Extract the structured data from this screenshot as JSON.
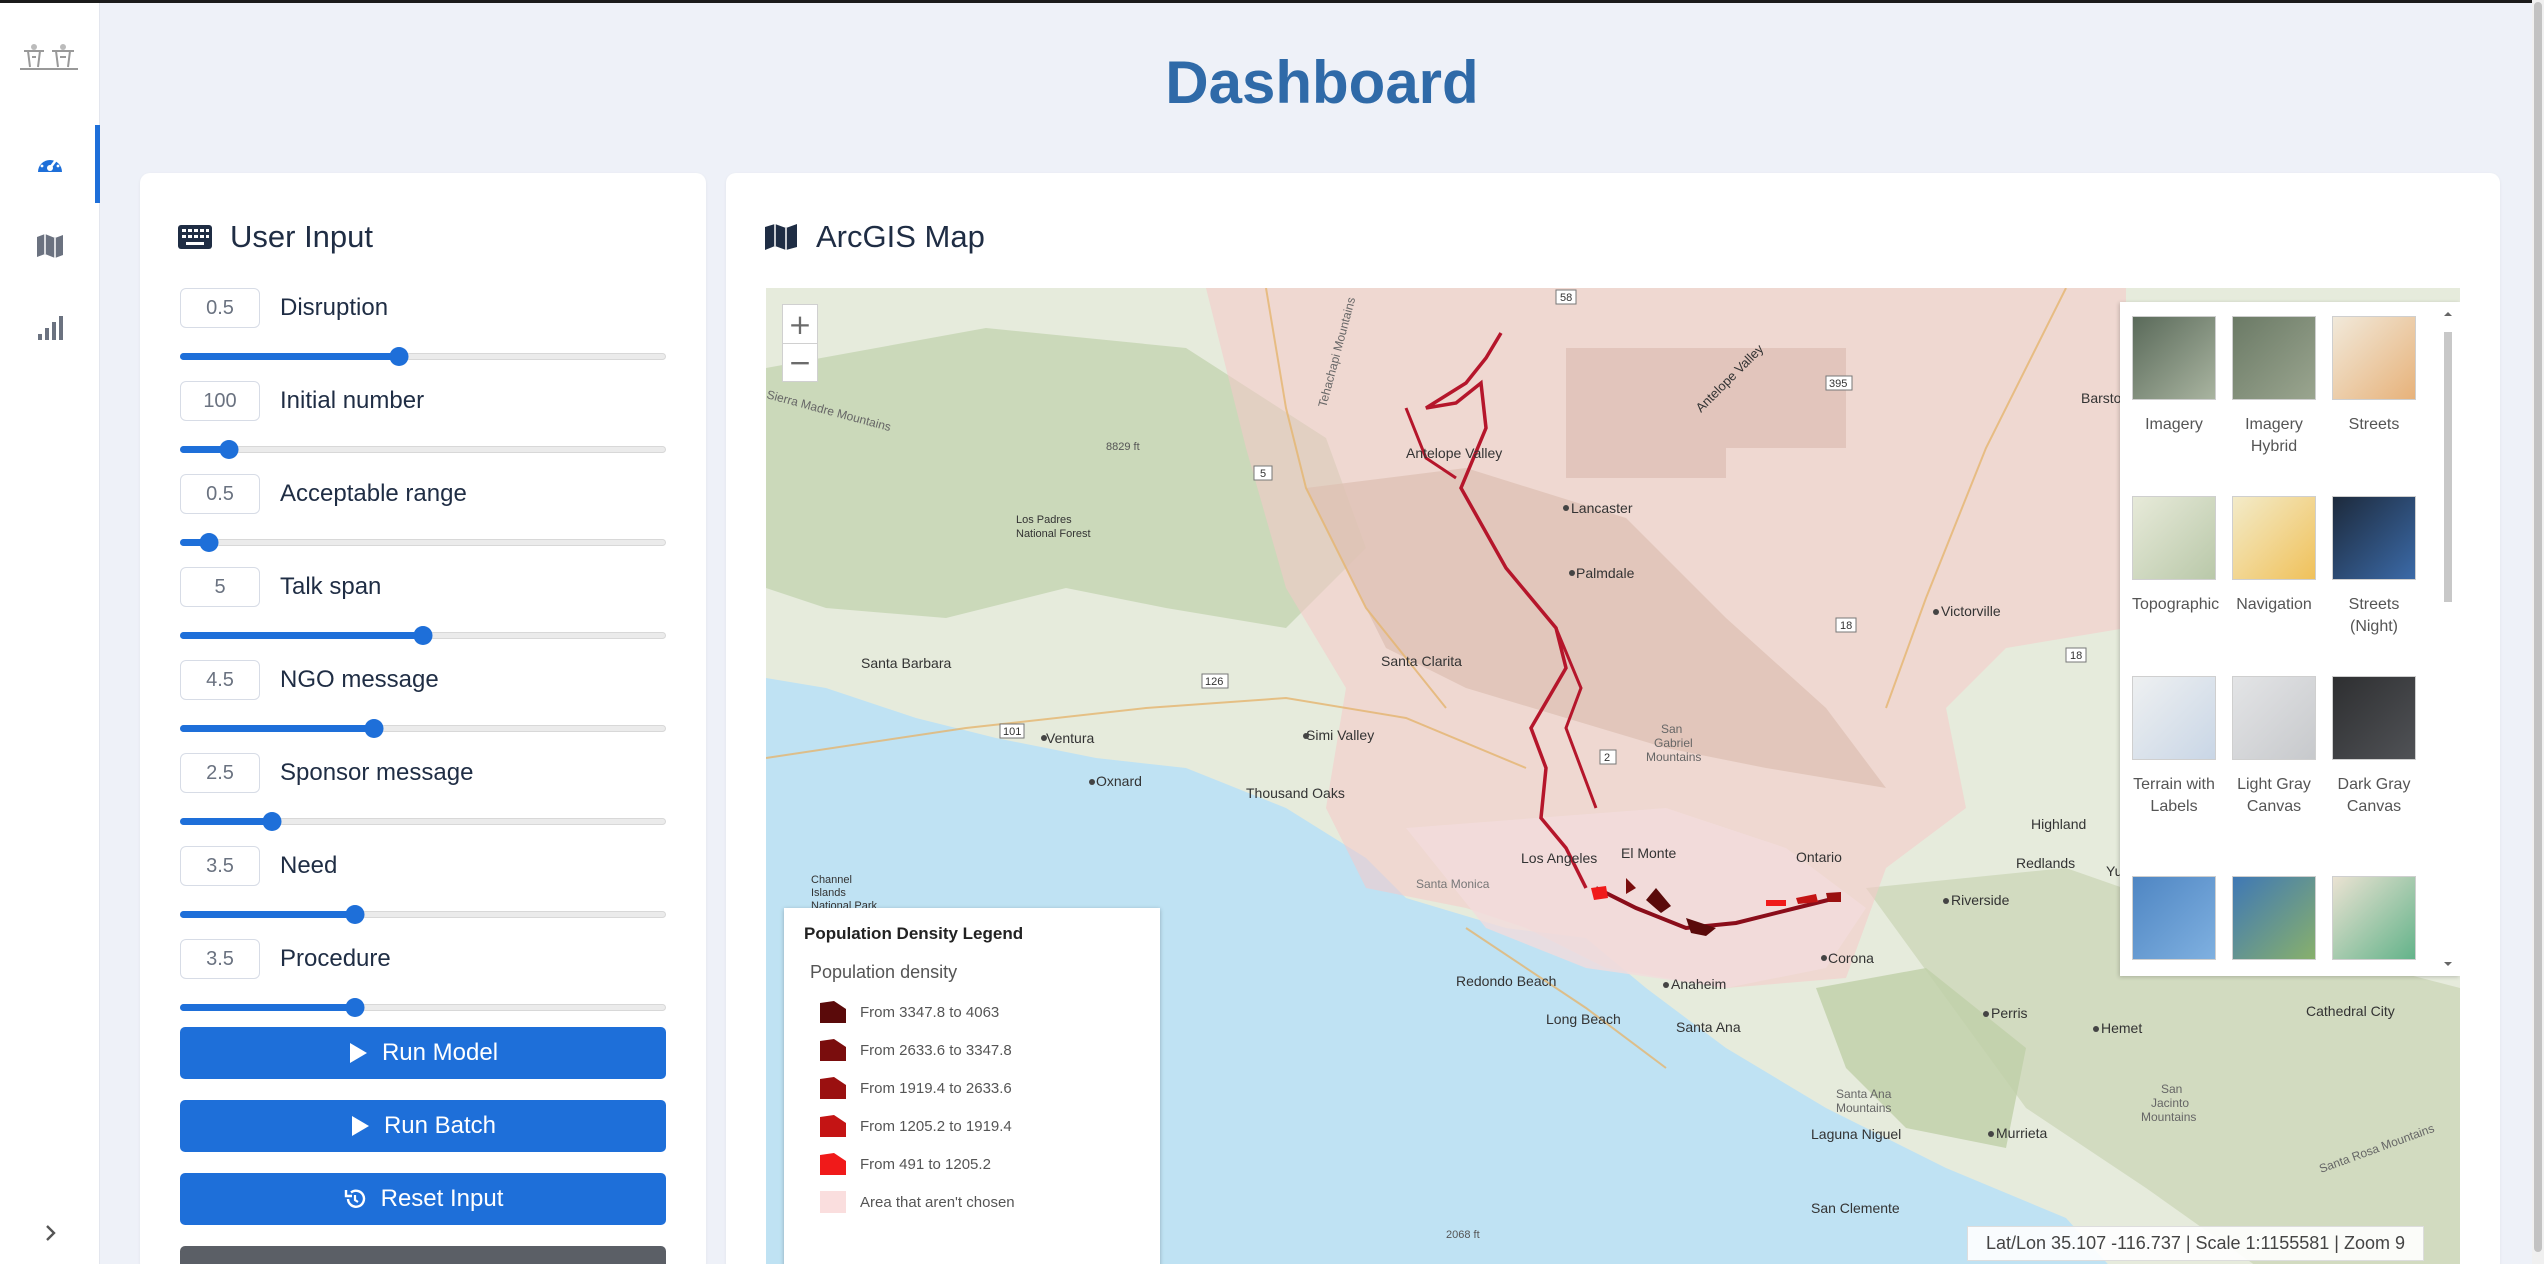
{
  "page": {
    "title": "Dashboard"
  },
  "sidebar": {
    "items": [
      {
        "icon": "dashboard-gauge-icon",
        "active": true
      },
      {
        "icon": "map-icon",
        "active": false
      },
      {
        "icon": "signal-bars-icon",
        "active": false
      }
    ],
    "toggle_icon": "chevron-right-icon"
  },
  "user_input": {
    "header": "User Input",
    "icon": "keyboard-icon",
    "params": [
      {
        "label": "Disruption",
        "value": "0.5",
        "slider_fraction": 0.45
      },
      {
        "label": "Initial number",
        "value": "100",
        "slider_fraction": 0.1
      },
      {
        "label": "Acceptable range",
        "value": "0.5",
        "slider_fraction": 0.06
      },
      {
        "label": "Talk span",
        "value": "5",
        "slider_fraction": 0.5
      },
      {
        "label": "NGO message",
        "value": "4.5",
        "slider_fraction": 0.4
      },
      {
        "label": "Sponsor message",
        "value": "2.5",
        "slider_fraction": 0.19
      },
      {
        "label": "Need",
        "value": "3.5",
        "slider_fraction": 0.36
      },
      {
        "label": "Procedure",
        "value": "3.5",
        "slider_fraction": 0.36
      }
    ],
    "buttons": {
      "run_model": "Run Model",
      "run_batch": "Run Batch",
      "reset_input": "Reset Input"
    }
  },
  "map": {
    "header": "ArcGIS Map",
    "icon": "map-icon",
    "zoom_in": "+",
    "zoom_out": "−",
    "place_labels": {
      "antelope_valley": "Antelope Valley",
      "antelope_valley_2": "Antelope Valley",
      "lancaster": "Lancaster",
      "palmdale": "Palmdale",
      "victorville": "Victorville",
      "santa_barbara": "Santa Barbara",
      "ventura": "Ventura",
      "oxnard": "Oxnard",
      "santa_clarita": "Santa Clarita",
      "simi_valley": "Simi Valley",
      "thousand_oaks": "Thousand Oaks",
      "los_angeles": "Los Angeles",
      "el_monte": "El Monte",
      "ontario": "Ontario",
      "highland": "Highland",
      "redlands": "Redlands",
      "yucaipa": "Yucaipa",
      "riverside": "Riverside",
      "corona": "Corona",
      "anaheim": "Anaheim",
      "redondo_beach": "Redondo Beach",
      "long_beach": "Long Beach",
      "santa_ana": "Santa Ana",
      "perris": "Perris",
      "hemet": "Hemet",
      "cathedral_city": "Cathedral City",
      "murrieta": "Murrieta",
      "laguna_niguel": "Laguna Niguel",
      "san_clemente": "San Clemente",
      "barstow": "Barstow",
      "los_padres": "Los Padres National Forest",
      "channel_islands": "Channel Islands National Park",
      "santa_monica": "Santa Monica",
      "san_gabriel": "San Gabriel Mountains",
      "san_jacinto": "San Jacinto Mountains",
      "santa_ana_mtns": "Santa Ana Mountains",
      "santa_rosa": "Santa Rosa Mountains",
      "tehachapi": "Tehachapi Mountains",
      "sierra_madre": "Sierra Madre Mountains",
      "peak_8829": "8829 ft",
      "peak_2068": "2068 ft"
    },
    "shields": [
      "58",
      "395",
      "5",
      "18",
      "126",
      "101",
      "18",
      "2"
    ],
    "basemap_gallery": [
      {
        "label": "Imagery"
      },
      {
        "label": "Imagery Hybrid"
      },
      {
        "label": "Streets"
      },
      {
        "label": "Topographic"
      },
      {
        "label": "Navigation"
      },
      {
        "label": "Streets (Night)"
      },
      {
        "label": "Terrain with Labels"
      },
      {
        "label": "Light Gray Canvas"
      },
      {
        "label": "Dark Gray Canvas"
      }
    ],
    "legend": {
      "title": "Population Density Legend",
      "subtitle": "Population density",
      "items": [
        {
          "label": "From 3347.8 to 4063",
          "color": "#5a0a0a"
        },
        {
          "label": "From 2633.6 to 3347.8",
          "color": "#7a0d0d"
        },
        {
          "label": "From 1919.4 to 2633.6",
          "color": "#9a1010"
        },
        {
          "label": "From 1205.2 to 1919.4",
          "color": "#c41414"
        },
        {
          "label": "From 491 to 1205.2",
          "color": "#f01a1a"
        },
        {
          "label": "Area that aren't chosen",
          "color": "#fadede"
        }
      ]
    },
    "status": "Lat/Lon 35.107 -116.737 | Scale 1:1155581 | Zoom 9"
  },
  "colors": {
    "accent": "#1e6fd9",
    "title": "#2f6aa8",
    "route": "#b5162b"
  }
}
